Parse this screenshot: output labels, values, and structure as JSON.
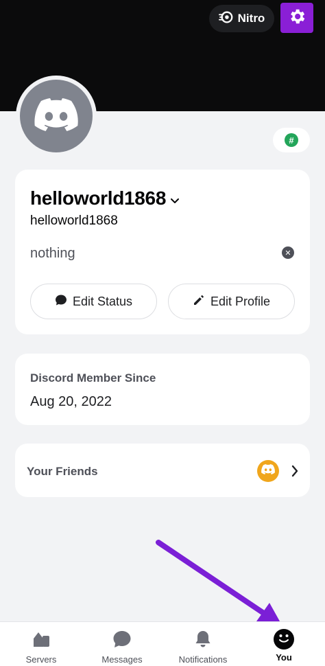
{
  "header": {
    "nitro_label": "Nitro",
    "nitro_icon": "nitro-icon",
    "settings_icon": "gear-icon",
    "settings_highlight": "#8a1fd6"
  },
  "profile": {
    "avatar_icon": "discord-logo-icon",
    "badge_icon": "hash-icon",
    "badge_symbol": "#",
    "display_name": "helloworld1868",
    "username": "helloworld1868",
    "status": "nothing",
    "edit_status_label": "Edit Status",
    "edit_profile_label": "Edit Profile"
  },
  "member_since": {
    "label": "Discord Member Since",
    "date": "Aug 20, 2022"
  },
  "friends": {
    "label": "Your Friends",
    "avatar_color": "#f0a61c"
  },
  "annotation": {
    "arrow_color": "#7b1fd6"
  },
  "bottom_nav": {
    "items": [
      {
        "label": "Servers",
        "icon": "servers-icon"
      },
      {
        "label": "Messages",
        "icon": "messages-icon"
      },
      {
        "label": "Notifications",
        "icon": "bell-icon"
      },
      {
        "label": "You",
        "icon": "you-avatar-icon",
        "active": true
      }
    ]
  }
}
